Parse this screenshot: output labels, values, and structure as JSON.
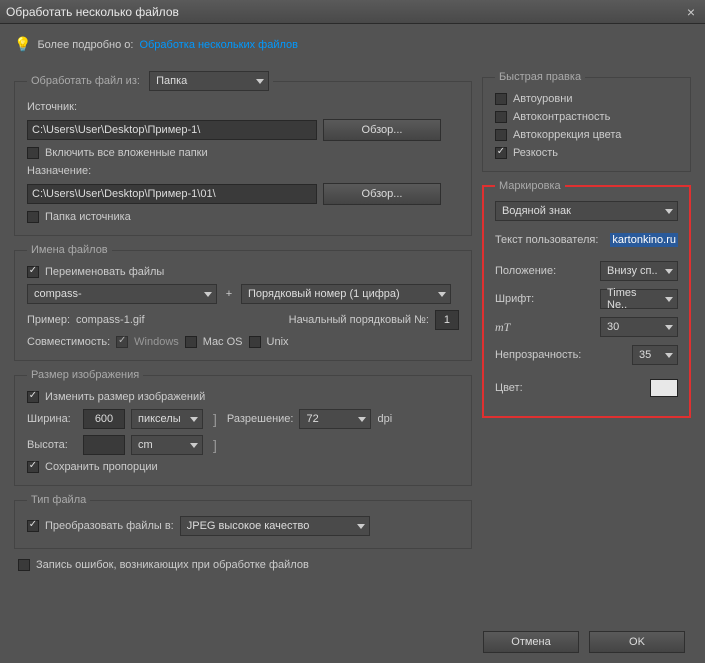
{
  "window": {
    "title": "Обработать несколько файлов"
  },
  "info": {
    "prefix": "Более подробно о:",
    "link": "Обработка нескольких файлов"
  },
  "process": {
    "legend": "Обработать файл из:",
    "folder_option": "Папка",
    "source_label": "Источник:",
    "source_path": "C:\\Users\\User\\Desktop\\Пример-1\\",
    "browse": "Обзор...",
    "include_sub": "Включить все вложенные папки",
    "dest_label": "Назначение:",
    "dest_path": "C:\\Users\\User\\Desktop\\Пример-1\\01\\",
    "same_as_source": "Папка источника"
  },
  "filenames": {
    "legend": "Имена файлов",
    "rename": "Переименовать файлы",
    "prefix_sel": "compass-",
    "seq_sel": "Порядковый номер (1 цифра)",
    "example_label": "Пример:",
    "example_val": "compass-1.gif",
    "startnum_label": "Начальный порядковый №:",
    "startnum_val": "1",
    "compat_label": "Совместимость:",
    "win": "Windows",
    "mac": "Mac OS",
    "unix": "Unix"
  },
  "imagesize": {
    "legend": "Размер изображения",
    "resize": "Изменить размер изображений",
    "width_lbl": "Ширина:",
    "width_val": "600",
    "width_unit": "пикселы",
    "height_lbl": "Высота:",
    "height_val": "",
    "height_unit": "cm",
    "res_lbl": "Разрешение:",
    "res_val": "72",
    "res_unit": "dpi",
    "constrain": "Сохранить пропорции"
  },
  "filetype": {
    "legend": "Тип файла",
    "convert": "Преобразовать файлы в:",
    "format": "JPEG высокое качество"
  },
  "log_label": "Запись ошибок, возникающих при обработке файлов",
  "quickfix": {
    "legend": "Быстрая правка",
    "auto_levels": "Автоуровни",
    "auto_contrast": "Автоконтрастность",
    "auto_color": "Автокоррекция цвета",
    "sharpen": "Резкость"
  },
  "watermark": {
    "legend": "Маркировка",
    "type": "Водяной знак",
    "usertext_lbl": "Текст пользователя:",
    "usertext_val": "kartonkino.ru",
    "position_lbl": "Положение:",
    "position_val": "Внизу сп..",
    "font_lbl": "Шрифт:",
    "font_val": "Times Ne..",
    "size_val": "30",
    "opacity_lbl": "Непрозрачность:",
    "opacity_val": "35",
    "color_lbl": "Цвет:"
  },
  "buttons": {
    "cancel": "Отмена",
    "ok": "OK"
  }
}
